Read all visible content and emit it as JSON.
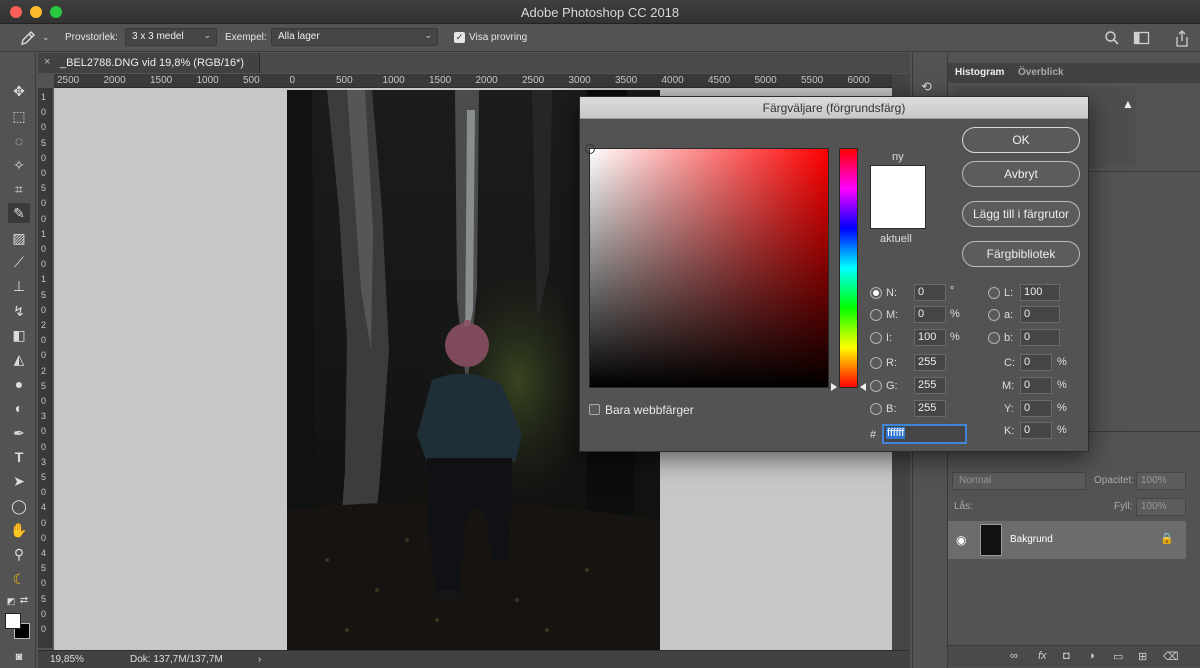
{
  "window": {
    "title": "Adobe Photoshop CC 2018"
  },
  "options_bar": {
    "sample_size_label": "Provstorlek:",
    "sample_size_value": "3 x 3 medel",
    "sample_label": "Exempel:",
    "sample_value": "Alla lager",
    "show_ring_label": "Visa provring"
  },
  "document": {
    "tab_title": "_BEL2788.DNG vid 19,8% (RGB/16*)",
    "close_glyph": "×"
  },
  "ruler": {
    "horizontal": [
      "2500",
      "2000",
      "1500",
      "1000",
      "500",
      "0",
      "500",
      "1000",
      "1500",
      "2000",
      "2500",
      "3000",
      "3500",
      "4000",
      "4500",
      "5000",
      "5500",
      "6000"
    ],
    "vertical": [
      "1",
      "0",
      "0",
      "5",
      "0",
      "0",
      "5",
      "0",
      "0",
      "1",
      "0",
      "0",
      "1",
      "5",
      "0",
      "2",
      "0",
      "0",
      "2",
      "5",
      "0",
      "3",
      "0",
      "0",
      "3",
      "5",
      "0",
      "4",
      "0",
      "0",
      "4",
      "5",
      "0",
      "5",
      "0",
      "0"
    ]
  },
  "status_bar": {
    "zoom": "19,85%",
    "doc_info": "Dok: 137,7M/137,7M",
    "arrow": "›"
  },
  "panels": {
    "tabs": [
      "Histogram",
      "Överblick"
    ],
    "warning_icon": "warning-icon"
  },
  "layers": {
    "blend_mode": "Normal",
    "opacity_label": "Opacitet:",
    "opacity_value": "100%",
    "lock_label": "Lås:",
    "fill_label": "Fyll:",
    "fill_value": "100%",
    "layer_name": "Bakgrund"
  },
  "color_picker": {
    "title": "Färgväljare (förgrundsfärg)",
    "new_label": "ny",
    "current_label": "aktuell",
    "buttons": {
      "ok": "OK",
      "cancel": "Avbryt",
      "add_to_swatches": "Lägg till i färgrutor",
      "color_libraries": "Färgbibliotek"
    },
    "web_colors_only": "Bara webbfärger",
    "new_color": "#ffffff",
    "current_color": "#ffffff",
    "fields": {
      "H": {
        "label": "N:",
        "value": "0",
        "unit": "°"
      },
      "S": {
        "label": "M:",
        "value": "0",
        "unit": "%"
      },
      "B": {
        "label": "I:",
        "value": "100",
        "unit": "%"
      },
      "R": {
        "label": "R:",
        "value": "255"
      },
      "G": {
        "label": "G:",
        "value": "255"
      },
      "Bl": {
        "label": "B:",
        "value": "255"
      },
      "L": {
        "label": "L:",
        "value": "100"
      },
      "a": {
        "label": "a:",
        "value": "0"
      },
      "b": {
        "label": "b:",
        "value": "0"
      },
      "C": {
        "label": "C:",
        "value": "0",
        "unit": "%"
      },
      "M": {
        "label": "M:",
        "value": "0",
        "unit": "%"
      },
      "Y": {
        "label": "Y:",
        "value": "0",
        "unit": "%"
      },
      "K": {
        "label": "K:",
        "value": "0",
        "unit": "%"
      }
    },
    "hex_label": "#",
    "hex_value": "ffffff"
  }
}
